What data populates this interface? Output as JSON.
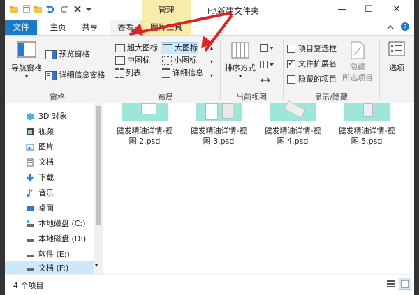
{
  "window": {
    "context_tab": "管理",
    "title": "F:\\新建文件夹",
    "minimize": "—",
    "maximize": "☐",
    "close": "✕"
  },
  "tabs": [
    {
      "label": "文件"
    },
    {
      "label": "主页"
    },
    {
      "label": "共享"
    },
    {
      "label": "查看"
    },
    {
      "label": "图片工具"
    }
  ],
  "ribbon": {
    "panes": {
      "nav_pane": "导航窗格",
      "preview_pane": "预览窗格",
      "details_pane": "详细信息窗格",
      "group_label": "窗格"
    },
    "layout": {
      "items": [
        "超大图标",
        "大图标",
        "中图标",
        "小图标",
        "列表",
        "详细信息"
      ],
      "group_label": "布局"
    },
    "current_view": {
      "sort": "排序方式",
      "group_label": "当前视图"
    },
    "show_hide": {
      "item_checkboxes": "项目复选框",
      "file_extensions": "文件扩展名",
      "hidden_items": "隐藏的项目",
      "hide_selected_1": "隐藏",
      "hide_selected_2": "所选项目",
      "group_label": "显示/隐藏"
    },
    "options": "选项"
  },
  "sidebar": {
    "items": [
      "3D 对象",
      "视频",
      "图片",
      "文档",
      "下载",
      "音乐",
      "桌面",
      "本地磁盘 (C:)",
      "本地磁盘 (D:)",
      "软件 (E:)",
      "文档 (F:)"
    ]
  },
  "files": [
    {
      "line1": "健发精油详情-视",
      "line2": "图 2.psd"
    },
    {
      "line1": "健发精油详情-视",
      "line2": "图 3.psd"
    },
    {
      "line1": "健发精油详情-视",
      "line2": "图 4.psd"
    },
    {
      "line1": "健发精油详情-视",
      "line2": "图 5.psd"
    }
  ],
  "status": {
    "count": "4 个项目"
  },
  "colors": {
    "accent": "#1979ca",
    "context": "#f7ecaa",
    "selection": "#cce8ff",
    "annotation_arrow": "#e52020"
  }
}
